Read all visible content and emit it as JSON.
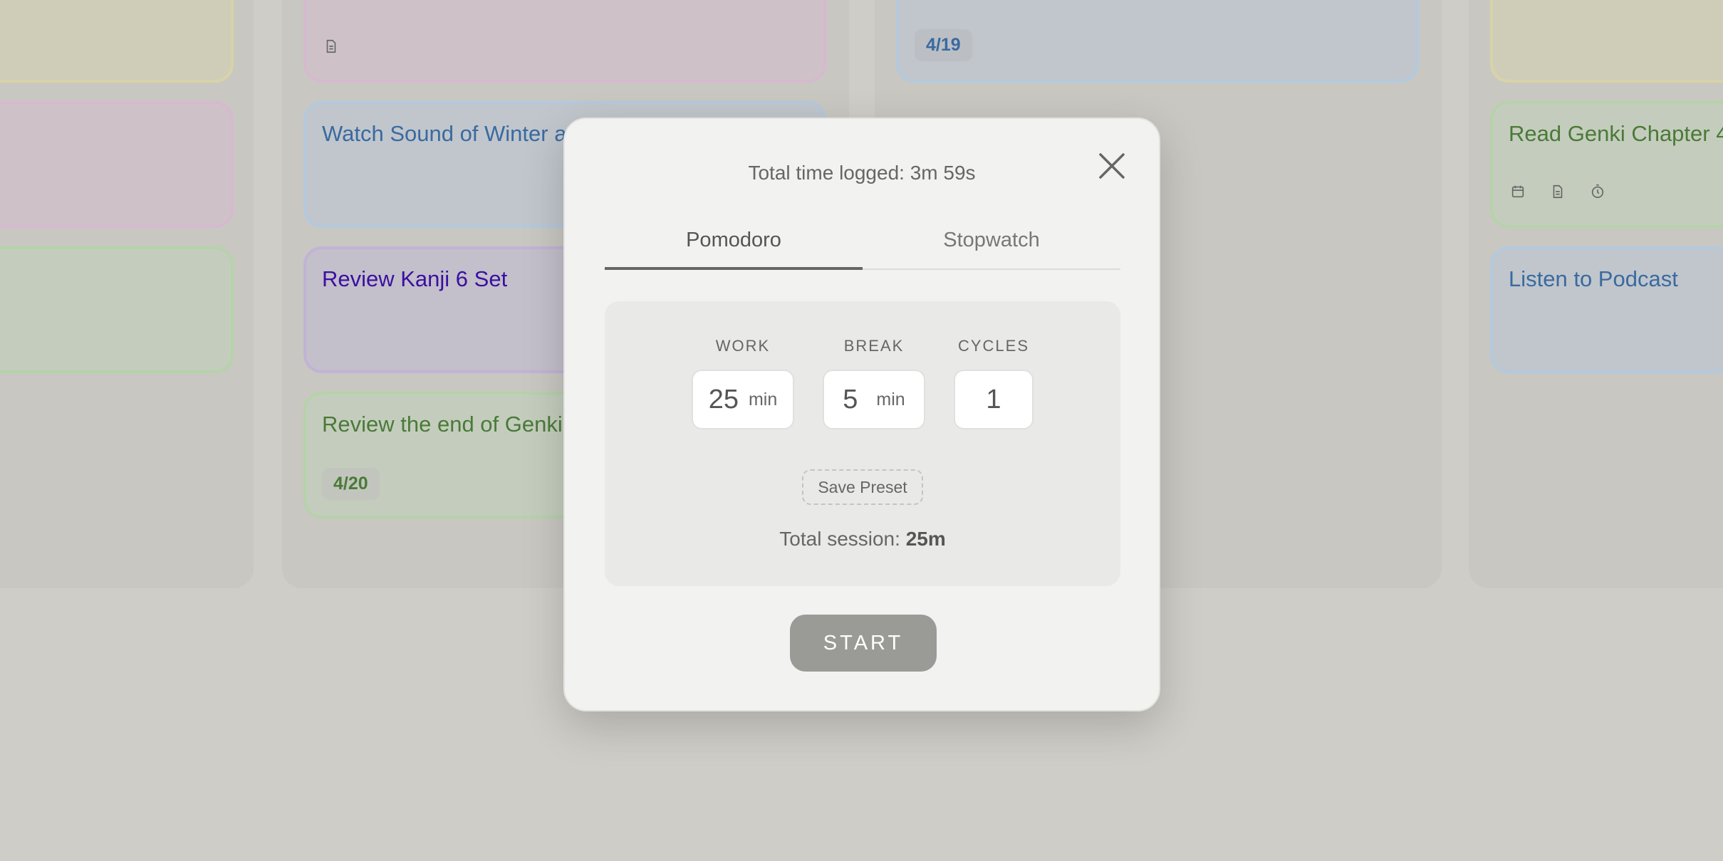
{
  "board": {
    "cards": {
      "watch_sound": "Watch Sound of Winter a",
      "review_kanji": "Review Kanji 6 Set",
      "review_genki": "Review the end of Genki",
      "review_genki_badge": "4/20",
      "top_badge": "4/19",
      "read_genki": "Read Genki Chapter 4",
      "listen_podcast": "Listen to Podcast"
    }
  },
  "modal": {
    "total_logged": "Total time logged: 3m 59s",
    "tabs": [
      {
        "label": "Pomodoro",
        "active": true
      },
      {
        "label": "Stopwatch",
        "active": false
      }
    ],
    "work": {
      "label": "WORK",
      "value": "25",
      "unit": "min"
    },
    "break": {
      "label": "BREAK",
      "value": "5",
      "unit": "min"
    },
    "cycles": {
      "label": "CYCLES",
      "value": "1"
    },
    "save_preset": "Save Preset",
    "total_session_label": "Total session:",
    "total_session_value": "25m",
    "start": "START"
  },
  "icons": [
    "close-icon",
    "calendar-icon",
    "document-icon",
    "timer-icon"
  ]
}
